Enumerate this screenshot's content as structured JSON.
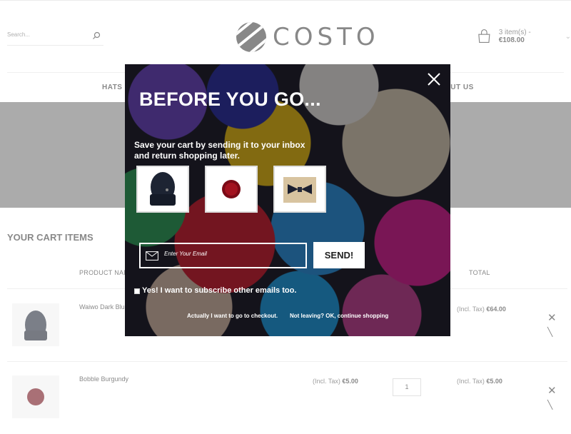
{
  "header": {
    "search_placeholder": "Search...",
    "logo_text": "COSTO",
    "cart_count": "3 item(s) -",
    "cart_total": "€108.00"
  },
  "nav": {
    "items": [
      "HATS",
      "OUT US"
    ]
  },
  "cart": {
    "title": "YOUR CART ITEMS",
    "columns": [
      "PRODUCT NAM",
      "TOTAL"
    ],
    "rows": [
      {
        "name": "Waiwo Dark Blu",
        "total_prefix": "(Incl. Tax)",
        "total": "€64.00"
      },
      {
        "name": "Bobble Burgundy",
        "price_prefix": "(Incl. Tax)",
        "price": "€5.00",
        "qty": "1",
        "total_prefix": "(Incl. Tax)",
        "total": "€5.00"
      }
    ]
  },
  "modal": {
    "title": "BEFORE YOU GO...",
    "text": "Save your cart by sending it to your inbox and return shopping later.",
    "email_placeholder": "Enter Your Email",
    "send_label": "SEND!",
    "subscribe_label": "Yes! I want to subscribe other emails too.",
    "checkout_link": "Actually I want to go to checkout.",
    "continue_link": "Not leaving? OK, continue shopping"
  },
  "colors": {
    "banner": "#6e6e6e",
    "overlay": "rgba(255,255,255,0.42)",
    "text_dark": "#333333"
  }
}
